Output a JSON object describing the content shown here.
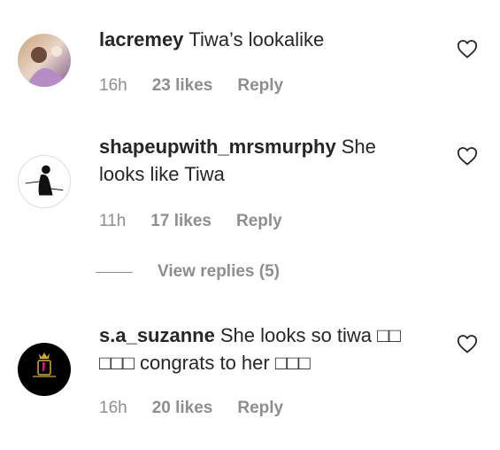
{
  "comments": [
    {
      "username": "lacremey",
      "text": "Tiwa’s lookalike",
      "time": "16h",
      "likes": "23 likes",
      "reply": "Reply",
      "avatar_icon": "photo-avatar"
    },
    {
      "username": "shapeupwith_mrsmurphy",
      "text": "She looks like Tiwa",
      "time": "11h",
      "likes": "17 likes",
      "reply": "Reply",
      "avatar_icon": "silhouette-logo-avatar"
    },
    {
      "username": "s.a_suzanne",
      "text": "She looks so tiwa □□ □□□ congrats to her □□□",
      "time": "16h",
      "likes": "20 likes",
      "reply": "Reply",
      "avatar_icon": "crown-logo-avatar"
    }
  ],
  "view_replies": "View replies (5)",
  "colors": {
    "text": "#262626",
    "muted": "#8e8e8e",
    "background": "#ffffff"
  },
  "icons": {
    "like": "heart-outline-icon"
  }
}
